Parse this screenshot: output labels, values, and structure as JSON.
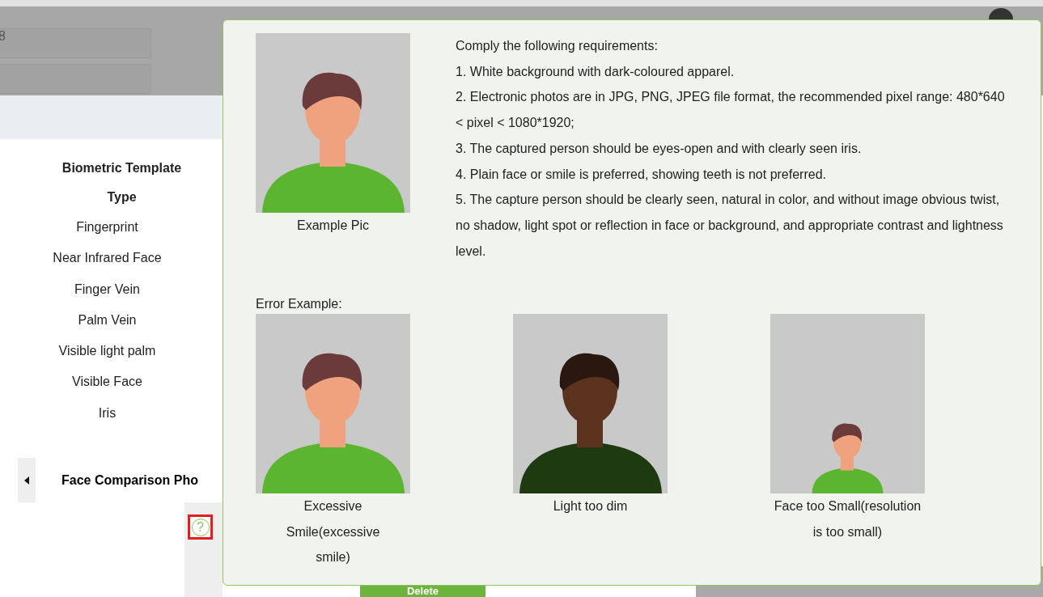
{
  "form": {
    "fields": [
      {
        "value": "8"
      }
    ]
  },
  "biometric_table": {
    "header": "Biometric Template Type",
    "rows": [
      "Fingerprint",
      "Near Infrared Face",
      "Finger Vein",
      "Palm Vein",
      "Visible light palm",
      "Visible Face",
      "Iris"
    ]
  },
  "tabs": [
    {
      "label": "Face Comparison Pho",
      "selected": true
    }
  ],
  "help_button": {
    "label": "?",
    "highlighted": true
  },
  "delete_button": {
    "label": "Delete"
  },
  "popup": {
    "example": {
      "kind": "picture",
      "caption": "Example Pic"
    },
    "requirements": [
      "Comply the following requirements:",
      "1. White background with dark-coloured apparel.",
      "2. Electronic photos are in JPG, PNG, JPEG file format, the recommended pixel range: 480*640 < pixel < 1080*1920;",
      "3. The captured person should be eyes-open and with clearly seen iris.",
      "4. Plain face or smile is preferred, showing teeth is not preferred.",
      "5. The capture person should be clearly seen, natural in color, and without image obvious twist, no shadow, light spot or reflection in face or background, and appropriate contrast and lightness level."
    ],
    "error_label": "Error Example:",
    "errors": [
      {
        "kind": "picture",
        "caption": "Excessive Smile(excessive smile)"
      },
      {
        "kind": "picture",
        "caption": "Light too dim"
      },
      {
        "kind": "picture",
        "caption": "Face too Small(resolution is too small)"
      }
    ]
  }
}
